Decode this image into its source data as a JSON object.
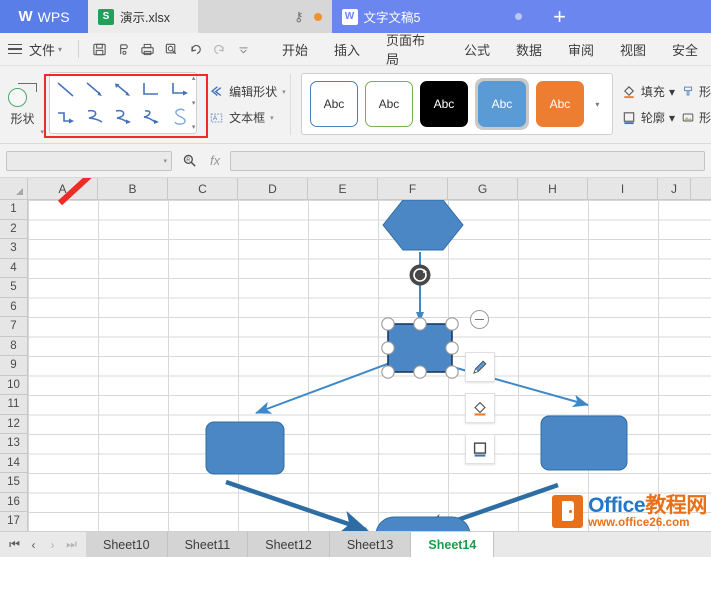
{
  "titlebar": {
    "app_badge": "WPS",
    "tabs": [
      {
        "name": "演示.xlsx",
        "icon": "excel-icon",
        "active": true
      },
      {
        "name": "文字文稿5",
        "icon": "word-icon",
        "active": false
      }
    ],
    "key_icon": "key-icon",
    "status_dot": "orange-dot",
    "new_tab": "+"
  },
  "menubar": {
    "file_label": "文件",
    "quick_icons": [
      "save-icon",
      "print-preview-icon",
      "print-icon",
      "find-icon",
      "undo-icon",
      "redo-icon",
      "customize-icon"
    ],
    "items": [
      "开始",
      "插入",
      "页面布局",
      "公式",
      "数据",
      "审阅",
      "视图",
      "安全"
    ]
  },
  "ribbon": {
    "shape_button": {
      "label": "形状",
      "icon": "shape-icon"
    },
    "gallery": {
      "highlighted": true,
      "highlight_color": "#ee2b26",
      "items": [
        "line-plain",
        "line-arrow",
        "line-double-arrow",
        "elbow-connector",
        "elbow-arrow-connector",
        "elbow-arrow-2",
        "curved-connector",
        "curved-arrow-connector",
        "curved-arrow-2",
        "freeform-curve"
      ]
    },
    "edit_shape": {
      "label": "编辑形状",
      "icon": "edit-shape-icon"
    },
    "text_box": {
      "label": "文本框",
      "icon": "textbox-icon"
    },
    "styles": {
      "sample_text": "Abc",
      "selected_index": 3,
      "swatches": [
        {
          "fill": "#ffffff",
          "border": "#4a7ebb",
          "text": "#333333"
        },
        {
          "fill": "#ffffff",
          "border": "#77b14b",
          "text": "#333333"
        },
        {
          "fill": "#000000",
          "border": "#000000",
          "text": "#ffffff"
        },
        {
          "fill": "#5b9bd5",
          "border": "#5b9bd5",
          "text": "#ffffff"
        },
        {
          "fill": "#ed7d31",
          "border": "#ed7d31",
          "text": "#ffffff"
        }
      ]
    },
    "fill_label": "填充",
    "outline_label": "轮廓",
    "effect_label": "形",
    "shadow_label": "形"
  },
  "formulabar": {
    "namebox_value": "",
    "search_icon": "search-icon",
    "fx_label": "fx",
    "formula_value": ""
  },
  "sheet": {
    "columns": [
      "A",
      "B",
      "C",
      "D",
      "E",
      "F",
      "G",
      "H",
      "I",
      "J"
    ],
    "rows": [
      "1",
      "2",
      "3",
      "4",
      "5",
      "6",
      "7",
      "8",
      "9",
      "10",
      "11",
      "12",
      "13",
      "14",
      "15",
      "16",
      "17"
    ],
    "shapes": [
      {
        "name": "hexagon-shape",
        "type": "hexagon",
        "fill": "#4a87c4",
        "stroke": "#2f6ca5"
      },
      {
        "name": "selected-rectangle-shape",
        "type": "rectangle",
        "fill": "#4a87c4",
        "stroke": "#1f3864",
        "selected": true
      },
      {
        "name": "left-rounded-rectangle-shape",
        "type": "rounded-rect",
        "fill": "#4a87c4",
        "stroke": "#2f6ca5"
      },
      {
        "name": "right-rounded-rectangle-shape",
        "type": "rounded-rect",
        "fill": "#4a87c4",
        "stroke": "#2f6ca5"
      },
      {
        "name": "bottom-stadium-shape",
        "type": "stadium",
        "fill": "#4a87c4",
        "stroke": "#2f6ca5"
      }
    ],
    "connectors": [
      {
        "name": "connector-center-to-left",
        "color": "#3e88c8",
        "width": 2
      },
      {
        "name": "connector-center-to-right",
        "color": "#3e88c8",
        "width": 2
      },
      {
        "name": "connector-left-to-bottom",
        "color": "#2e6da4",
        "width": 4
      },
      {
        "name": "connector-right-to-bottom",
        "color": "#2e6da4",
        "width": 4
      }
    ],
    "mini_toolbar": {
      "collapse": "minus-circle-icon",
      "buttons": [
        "brush-icon",
        "fill-bucket-icon",
        "outline-icon"
      ]
    },
    "annotation_arrow": {
      "name": "red-annotation-arrow",
      "color": "#ee2b26"
    },
    "watermark": {
      "brand": "Office",
      "brand_cn": "教程网",
      "url": "www.office26.com"
    }
  },
  "sheetbar": {
    "nav": [
      "first-sheet-icon",
      "prev-sheet-icon",
      "next-sheet-icon",
      "last-sheet-icon"
    ],
    "tabs": [
      {
        "label": "Sheet10",
        "active": false
      },
      {
        "label": "Sheet11",
        "active": false
      },
      {
        "label": "Sheet12",
        "active": false
      },
      {
        "label": "Sheet13",
        "active": false
      },
      {
        "label": "Sheet14",
        "active": true
      }
    ]
  }
}
